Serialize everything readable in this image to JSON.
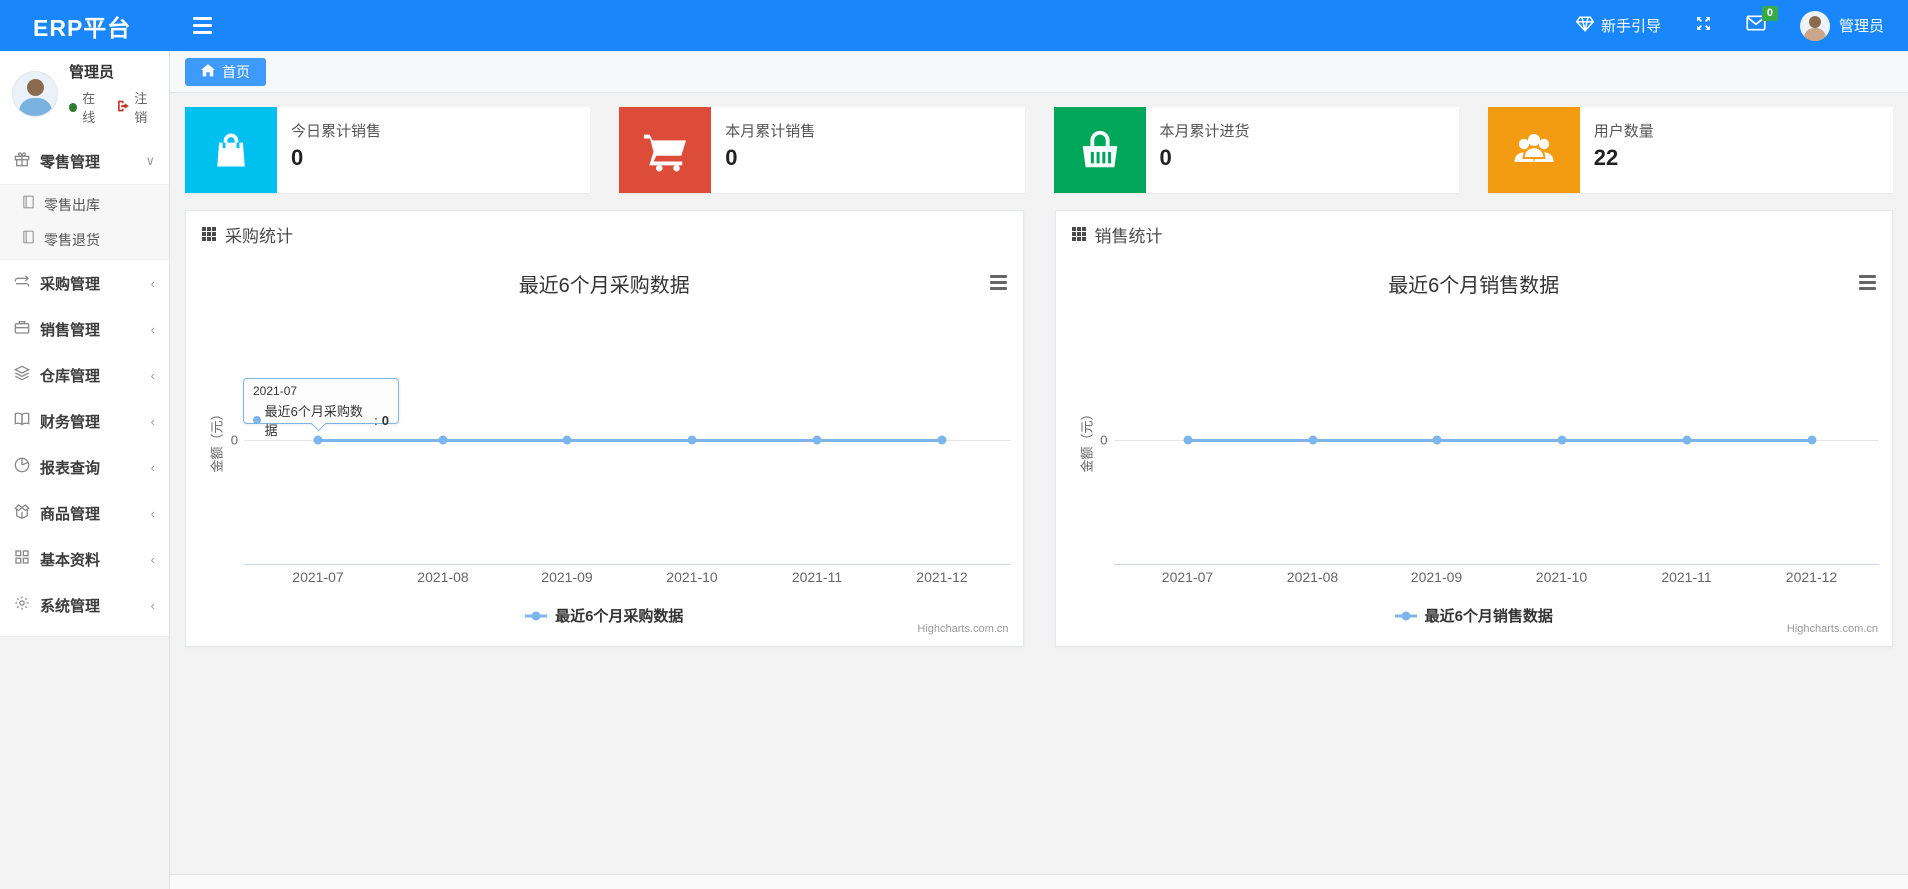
{
  "header": {
    "app_title": "ERP平台",
    "guide_label": "新手引导",
    "message_badge": "0",
    "user_label": "管理员"
  },
  "sidebar": {
    "user": {
      "name": "管理员",
      "status": "在线",
      "logout": "注销"
    },
    "items": [
      {
        "label": "零售管理",
        "icon": "gift-icon",
        "expanded": true
      },
      {
        "label": "采购管理",
        "icon": "repeat-icon",
        "expanded": false
      },
      {
        "label": "销售管理",
        "icon": "briefcase-icon",
        "expanded": false
      },
      {
        "label": "仓库管理",
        "icon": "layers-icon",
        "expanded": false
      },
      {
        "label": "财务管理",
        "icon": "book-open-icon",
        "expanded": false
      },
      {
        "label": "报表查询",
        "icon": "pie-chart-icon",
        "expanded": false
      },
      {
        "label": "商品管理",
        "icon": "package-icon",
        "expanded": false
      },
      {
        "label": "基本资料",
        "icon": "grid-icon",
        "expanded": false
      },
      {
        "label": "系统管理",
        "icon": "gear-icon",
        "expanded": false
      }
    ],
    "submenu": [
      {
        "label": "零售出库",
        "icon": "book-icon"
      },
      {
        "label": "零售退货",
        "icon": "book-icon"
      }
    ]
  },
  "breadcrumb": {
    "home": "首页"
  },
  "stat_cards": [
    {
      "title": "今日累计销售",
      "value": "0",
      "color": "#00c0ef",
      "icon": "shopping-bag-icon"
    },
    {
      "title": "本月累计销售",
      "value": "0",
      "color": "#dd4b39",
      "icon": "shopping-cart-icon"
    },
    {
      "title": "本月累计进货",
      "value": "0",
      "color": "#00a65a",
      "icon": "basket-icon"
    },
    {
      "title": "用户数量",
      "value": "22",
      "color": "#f39c12",
      "icon": "users-icon"
    }
  ],
  "panels": [
    {
      "title": "采购统计"
    },
    {
      "title": "销售统计"
    }
  ],
  "chart_data": [
    {
      "type": "line",
      "title": "最近6个月采购数据",
      "categories": [
        "2021-07",
        "2021-08",
        "2021-09",
        "2021-10",
        "2021-11",
        "2021-12"
      ],
      "series": [
        {
          "name": "最近6个月采购数据",
          "values": [
            0,
            0,
            0,
            0,
            0,
            0
          ]
        }
      ],
      "xlabel": "",
      "ylabel": "金额（元）",
      "ytick": "0",
      "ylim": [
        0,
        1
      ],
      "grid": true,
      "legend_position": "bottom",
      "line_color": "#7cb5ec",
      "credits": "Highcharts.com.cn",
      "tooltip": {
        "x": "2021-07",
        "label": "最近6个月采购数据",
        "separator": ":",
        "value": "0"
      }
    },
    {
      "type": "line",
      "title": "最近6个月销售数据",
      "categories": [
        "2021-07",
        "2021-08",
        "2021-09",
        "2021-10",
        "2021-11",
        "2021-12"
      ],
      "series": [
        {
          "name": "最近6个月销售数据",
          "values": [
            0,
            0,
            0,
            0,
            0,
            0
          ]
        }
      ],
      "xlabel": "",
      "ylabel": "金额（元）",
      "ytick": "0",
      "ylim": [
        0,
        1
      ],
      "grid": true,
      "legend_position": "bottom",
      "line_color": "#7cb5ec",
      "credits": "Highcharts.com.cn"
    }
  ]
}
